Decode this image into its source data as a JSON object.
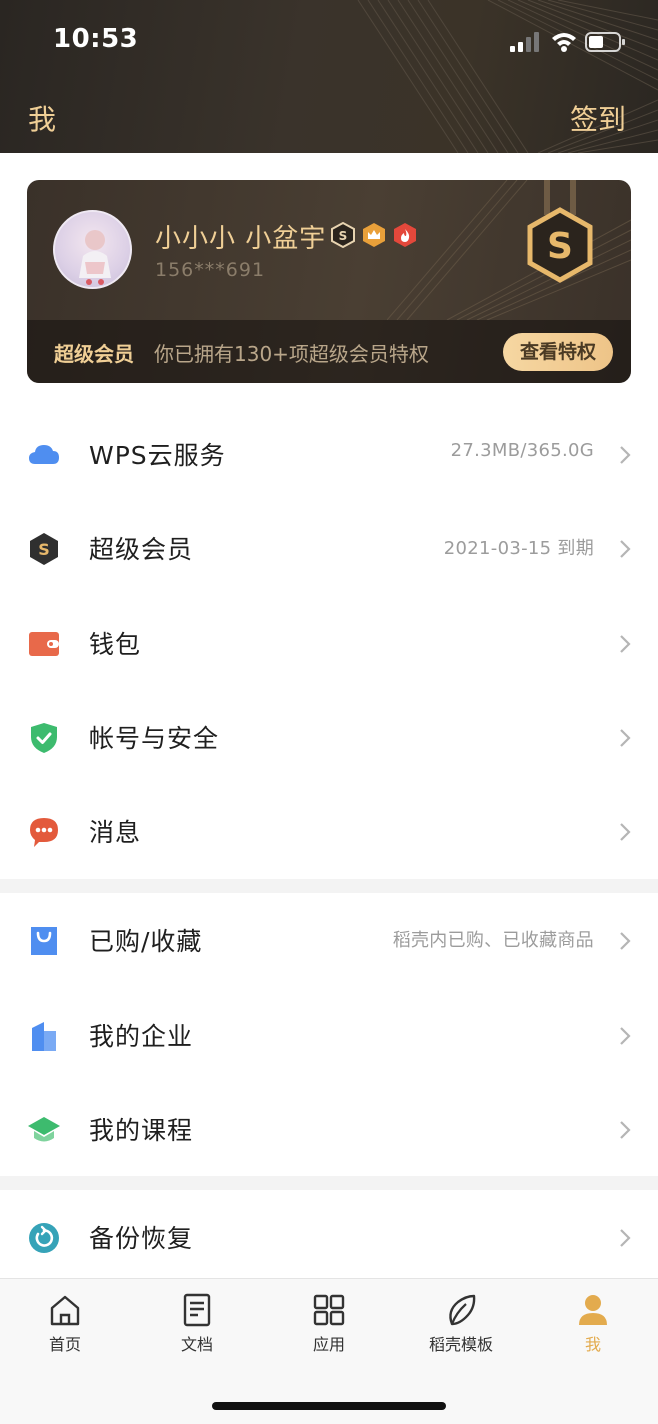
{
  "status_bar": {
    "time": "10:53"
  },
  "header": {
    "title": "我",
    "signin_label": "签到"
  },
  "member_card": {
    "username": "小小小 小盆宇",
    "phone": "156***691",
    "vip_label": "超级会员",
    "vip_description": "你已拥有130+项超级会员特权",
    "privilege_button": "查看特权"
  },
  "menu_group_1": [
    {
      "label": "WPS云服务",
      "value": "27.3MB/365.0G",
      "icon": "cloud-icon",
      "color": "#4f8ef0"
    },
    {
      "label": "超级会员",
      "value": "2021-03-15 到期",
      "icon": "super-vip-icon",
      "color": "#2f2f2f"
    },
    {
      "label": "钱包",
      "value": "",
      "icon": "wallet-icon",
      "color": "#e8694a"
    },
    {
      "label": "帐号与安全",
      "value": "",
      "icon": "shield-icon",
      "color": "#3dbb6e"
    },
    {
      "label": "消息",
      "value": "",
      "icon": "message-icon",
      "color": "#e35a3c"
    }
  ],
  "menu_group_2": [
    {
      "label": "已购/收藏",
      "value": "稻壳内已购、已收藏商品",
      "icon": "shopping-bag-icon",
      "color": "#4f8ef0"
    },
    {
      "label": "我的企业",
      "value": "",
      "icon": "enterprise-icon",
      "color": "#4f8ef0"
    },
    {
      "label": "我的课程",
      "value": "",
      "icon": "course-icon",
      "color": "#3dbb6e"
    }
  ],
  "menu_group_3": [
    {
      "label": "备份恢复",
      "value": "",
      "icon": "backup-icon",
      "color": "#36a3b8"
    }
  ],
  "tab_bar": [
    {
      "label": "首页",
      "icon": "home-icon",
      "active": false
    },
    {
      "label": "文档",
      "icon": "document-icon",
      "active": false
    },
    {
      "label": "应用",
      "icon": "apps-icon",
      "active": false
    },
    {
      "label": "稻壳模板",
      "icon": "template-icon",
      "active": false
    },
    {
      "label": "我",
      "icon": "profile-icon",
      "active": true
    }
  ],
  "colors": {
    "gold": "#f0cf96",
    "accent": "#e3ab4e",
    "header_bg": "#2e2924"
  }
}
